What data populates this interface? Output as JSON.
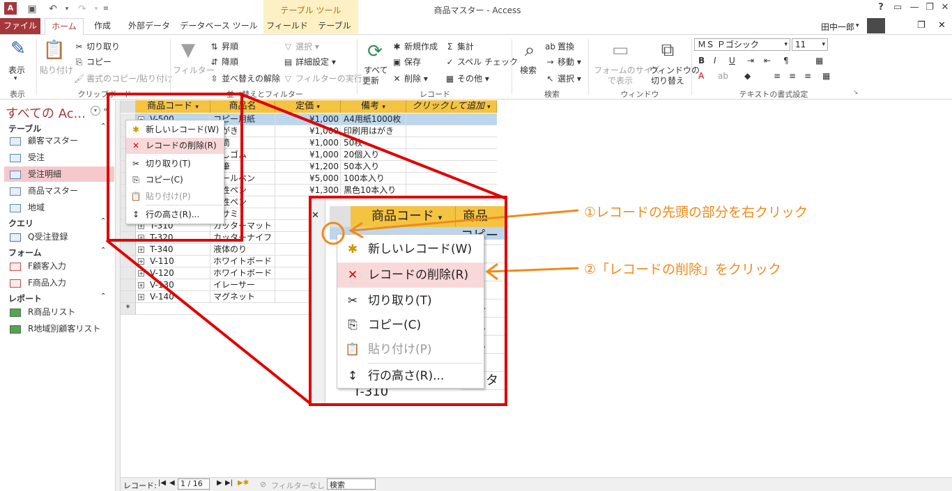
{
  "window": {
    "title": "商品マスター - Access",
    "context_tab_title": "テーブル ツール",
    "user": "田中一郎",
    "help": "?"
  },
  "tabs": [
    "ファイル",
    "ホーム",
    "作成",
    "外部データ",
    "データベース ツール",
    "フィールド",
    "テーブル"
  ],
  "ribbon": {
    "view": {
      "label": "表示",
      "group": "表示"
    },
    "clipboard": {
      "paste": "貼り付け",
      "cut": "切り取り",
      "copy": "コピー",
      "format_painter": "書式のコピー/貼り付け",
      "group": "クリップボード"
    },
    "sort_filter": {
      "filter": "フィルター",
      "ascending": "昇順",
      "descending": "降順",
      "remove_sort": "並べ替えの解除",
      "selection": "選択",
      "advanced": "詳細設定",
      "toggle_filter": "フィルターの実行",
      "group": "並べ替えとフィルター"
    },
    "records": {
      "refresh_line1": "すべて",
      "refresh_line2": "更新",
      "new": "新規作成",
      "save": "保存",
      "delete": "削除",
      "totals": "集計",
      "spelling": "スペル チェック",
      "more": "その他",
      "group": "レコード"
    },
    "find": {
      "find": "検索",
      "replace": "置換",
      "goto": "移動",
      "select": "選択",
      "group": "検索"
    },
    "window": {
      "fit_line1": "フォームのサイズ",
      "fit_line2": "で表示",
      "switch_line1": "ウィンドウの",
      "switch_line2": "切り替え",
      "group": "ウィンドウ"
    },
    "text_format": {
      "font": "ＭＳ Ｐゴシック",
      "size": "11",
      "bold": "B",
      "italic": "I",
      "underline": "U",
      "group": "テキストの書式設定"
    }
  },
  "nav": {
    "title": "すべての Ac...",
    "sections": [
      {
        "label": "テーブル",
        "items": [
          "顧客マスター",
          "受注",
          "受注明細",
          "商品マスター",
          "地域"
        ]
      },
      {
        "label": "クエリ",
        "items": [
          "Q受注登録"
        ]
      },
      {
        "label": "フォーム",
        "items": [
          "F顧客入力",
          "F商品入力"
        ]
      },
      {
        "label": "レポート",
        "items": [
          "R商品リスト",
          "R地域別顧客リスト"
        ]
      }
    ]
  },
  "table": {
    "columns": [
      "商品コード",
      "商品名",
      "定価",
      "備考",
      "クリックして追加"
    ],
    "rows": [
      [
        "V-500",
        "コピー用紙",
        "¥1,000",
        "A4用紙1000枚"
      ],
      [
        "",
        "はがき",
        "¥1,000",
        "印刷用はがき"
      ],
      [
        "",
        "封筒",
        "¥1,000",
        "50枚"
      ],
      [
        "",
        "消しゴム",
        "¥1,000",
        "20個入り"
      ],
      [
        "",
        "鉛筆",
        "¥1,200",
        "50本入り"
      ],
      [
        "",
        "ボールペン",
        "¥5,000",
        "100本入り"
      ],
      [
        "",
        "油性ペン",
        "¥1,300",
        "黒色10本入り"
      ],
      [
        "",
        "水性ペン",
        "",
        ""
      ],
      [
        "",
        "ハサミ",
        "",
        ""
      ],
      [
        "T-310",
        "カッターマット",
        "",
        ""
      ],
      [
        "T-320",
        "カッターナイフ",
        "",
        ""
      ],
      [
        "T-340",
        "液体のり",
        "",
        ""
      ],
      [
        "V-110",
        "ホワイトボード",
        "¥",
        ""
      ],
      [
        "V-120",
        "ホワイトボード",
        "",
        ""
      ],
      [
        "V-130",
        "イレーサー",
        "",
        ""
      ],
      [
        "V-140",
        "マグネット",
        "",
        ""
      ]
    ],
    "new_row_marker": "*"
  },
  "context_menu": {
    "items": [
      "新しいレコード(W)",
      "レコードの削除(R)",
      "切り取り(T)",
      "コピー(C)",
      "貼り付け(P)",
      "行の高さ(R)..."
    ]
  },
  "zoom": {
    "header": [
      "商品コード",
      "商品"
    ],
    "row_code": "T-310",
    "row_names": [
      "コピー",
      "がき",
      "ゴ",
      "筆",
      "ール",
      "性へ",
      "性へ",
      "サミ",
      "カッター"
    ]
  },
  "annotations": {
    "step1": "①レコードの先頭の部分を右クリック",
    "step2": "②「レコードの削除」をクリック"
  },
  "status": {
    "label": "レコード:",
    "position": "1 / 16",
    "filter": "フィルターなし",
    "search": "検索"
  },
  "colors": {
    "accent": "#a4373a",
    "header": "#f5c342",
    "highlight": "#f9d8d9",
    "annotation": "#f08a18",
    "callout": "#e00000"
  }
}
